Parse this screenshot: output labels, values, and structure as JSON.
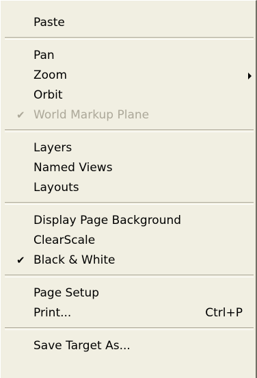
{
  "menu": {
    "groups": [
      {
        "items": [
          {
            "label": "Paste"
          }
        ]
      },
      {
        "items": [
          {
            "label": "Pan"
          },
          {
            "label": "Zoom",
            "submenu": true
          },
          {
            "label": "Orbit"
          },
          {
            "label": "World Markup Plane",
            "checked": true,
            "disabled": true
          }
        ]
      },
      {
        "items": [
          {
            "label": "Layers"
          },
          {
            "label": "Named Views"
          },
          {
            "label": "Layouts"
          }
        ]
      },
      {
        "items": [
          {
            "label": "Display Page Background"
          },
          {
            "label": "ClearScale"
          },
          {
            "label": "Black & White",
            "checked": true
          }
        ]
      },
      {
        "items": [
          {
            "label": "Page Setup"
          },
          {
            "label": "Print...",
            "shortcut": "Ctrl+P"
          }
        ]
      },
      {
        "items": [
          {
            "label": "Save Target As..."
          }
        ]
      }
    ],
    "check_glyph": "✔"
  }
}
